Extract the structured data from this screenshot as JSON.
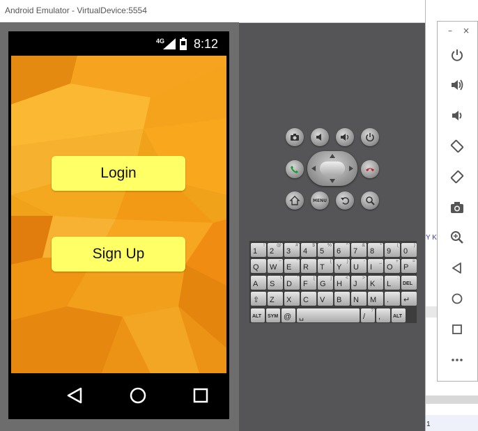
{
  "window": {
    "title": "Android Emulator - VirtualDevice:5554"
  },
  "status_bar": {
    "network": "4G",
    "time": "8:12"
  },
  "app": {
    "login_label": "Login",
    "signup_label": "Sign Up"
  },
  "keyboard": {
    "rows": [
      [
        {
          "m": "1",
          "s": "!"
        },
        {
          "m": "2",
          "s": "@"
        },
        {
          "m": "3",
          "s": "#"
        },
        {
          "m": "4",
          "s": "$"
        },
        {
          "m": "5",
          "s": "%"
        },
        {
          "m": "6",
          "s": "^"
        },
        {
          "m": "7",
          "s": "&"
        },
        {
          "m": "8",
          "s": "*"
        },
        {
          "m": "9",
          "s": "("
        },
        {
          "m": "0",
          "s": ")"
        }
      ],
      [
        {
          "m": "Q",
          "s": ""
        },
        {
          "m": "W",
          "s": "~"
        },
        {
          "m": "E",
          "s": "\""
        },
        {
          "m": "R",
          "s": "`"
        },
        {
          "m": "T",
          "s": "{"
        },
        {
          "m": "Y",
          "s": "}"
        },
        {
          "m": "U",
          "s": "-"
        },
        {
          "m": "I",
          "s": "_"
        },
        {
          "m": "O",
          "s": "+"
        },
        {
          "m": "P",
          "s": "="
        }
      ],
      [
        {
          "m": "A",
          "s": ""
        },
        {
          "m": "S",
          "s": "\\"
        },
        {
          "m": "D",
          "s": "'"
        },
        {
          "m": "F",
          "s": "["
        },
        {
          "m": "G",
          "s": "]"
        },
        {
          "m": "H",
          "s": "<"
        },
        {
          "m": "J",
          "s": ">"
        },
        {
          "m": "K",
          "s": ";"
        },
        {
          "m": "L",
          "s": ":"
        },
        {
          "m": "DEL",
          "s": ""
        }
      ],
      [
        {
          "m": "⇧",
          "s": ""
        },
        {
          "m": "Z",
          "s": ""
        },
        {
          "m": "X",
          "s": ""
        },
        {
          "m": "C",
          "s": ""
        },
        {
          "m": "V",
          "s": ""
        },
        {
          "m": "B",
          "s": ""
        },
        {
          "m": "N",
          "s": ""
        },
        {
          "m": "M",
          "s": ""
        },
        {
          "m": ".",
          "s": ""
        },
        {
          "m": "↵",
          "s": ""
        }
      ],
      [
        {
          "m": "ALT",
          "s": ""
        },
        {
          "m": "SYM",
          "s": ""
        },
        {
          "m": "@",
          "s": ""
        },
        {
          "m": "␣",
          "s": ""
        },
        {
          "m": "/",
          "s": "?"
        },
        {
          "m": ",",
          "s": ""
        },
        {
          "m": "ALT",
          "s": ""
        }
      ]
    ]
  },
  "side_panel": {
    "minimize": "–",
    "close": "×",
    "icons": [
      "power-icon",
      "volume-up-icon",
      "volume-down-icon",
      "rotate-left-icon",
      "rotate-right-icon",
      "camera-icon",
      "zoom-icon",
      "back-icon",
      "home-icon",
      "overview-icon",
      "more-icon"
    ]
  },
  "background": {
    "frag_text_1": "Y K",
    "frag_text_2": "1"
  },
  "colors": {
    "button_yellow": "#ffff66",
    "bg_orange": "#f39c12",
    "emulator_gray": "#555557"
  }
}
